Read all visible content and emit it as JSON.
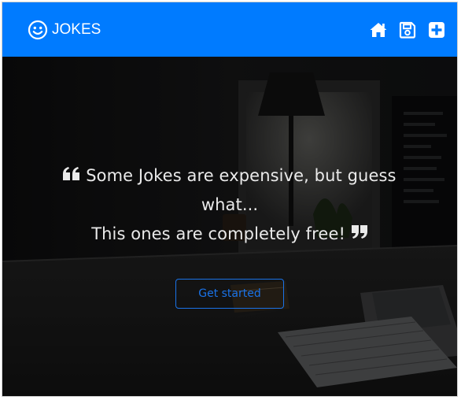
{
  "navbar": {
    "brand_label": "JOKES",
    "brand_icon": "smiley-icon",
    "links": [
      {
        "name": "home",
        "icon": "home-icon"
      },
      {
        "name": "saved",
        "icon": "save-icon"
      },
      {
        "name": "add",
        "icon": "plus-square-icon"
      }
    ],
    "color": "#007bff"
  },
  "hero": {
    "quote_line1": "Some Jokes are expensive, but guess what...",
    "quote_line2": "This ones are completely free!",
    "cta_label": "Get started",
    "cta_color": "#1a73e8"
  }
}
